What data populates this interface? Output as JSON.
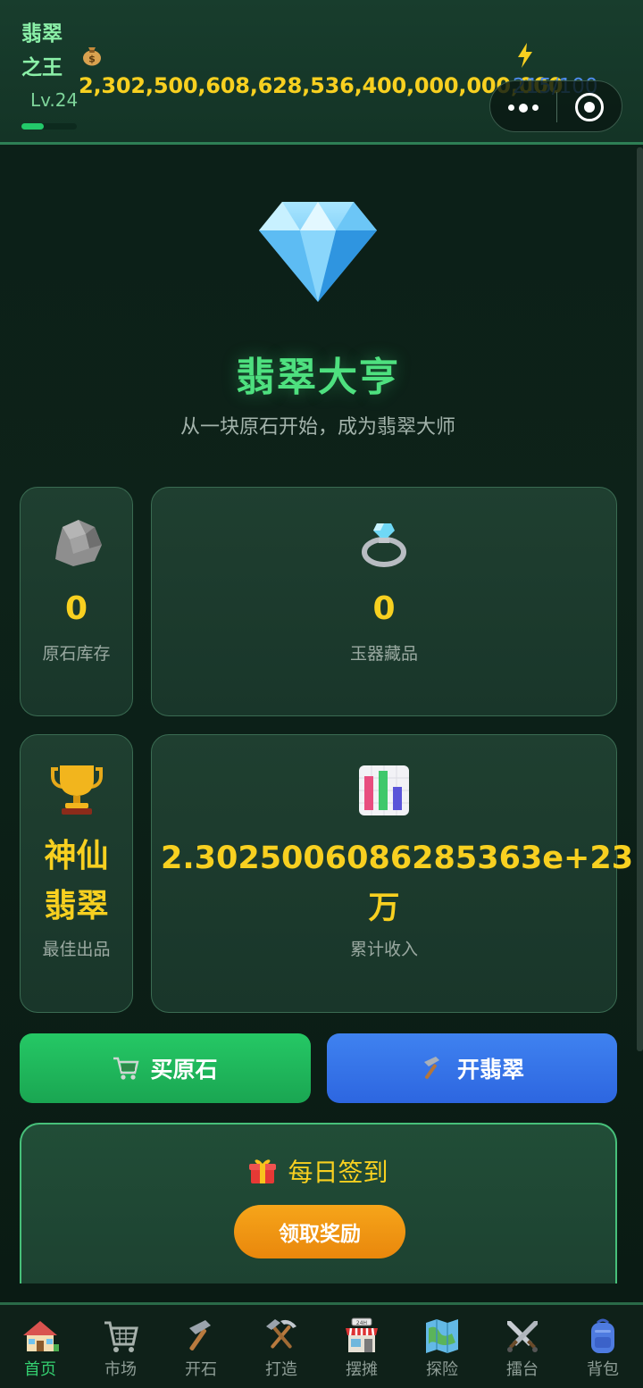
{
  "header": {
    "title_line1": "翡翠",
    "title_line2": "之王",
    "level": "Lv.24",
    "xp_fraction": 0.4,
    "money_icon": "money-bag-icon",
    "money": "2,302,500,608,628,536,400,000,000,000",
    "energy_icon": "lightning-icon",
    "energy": "215/100"
  },
  "hero": {
    "icon": "diamond-icon",
    "title": "翡翠大亨",
    "subtitle": "从一块原石开始，成为翡翠大师"
  },
  "stats": [
    {
      "icon": "rock-icon",
      "value": "0",
      "label": "原石库存"
    },
    {
      "icon": "ring-icon",
      "value": "0",
      "label": "玉器藏品"
    },
    {
      "icon": "trophy-icon",
      "value": "神仙翡翠",
      "label": "最佳出品"
    },
    {
      "icon": "bar-chart-icon",
      "value": "2.3025006086285363e+23万",
      "label": "累计收入"
    }
  ],
  "actions": {
    "buy_label": "买原石",
    "buy_icon": "cart-icon",
    "open_label": "开翡翠",
    "open_icon": "hammer-icon"
  },
  "daily": {
    "icon": "gift-icon",
    "title": "每日签到",
    "claim_label": "领取奖励"
  },
  "nav": {
    "active": "首页",
    "items": [
      {
        "label": "首页",
        "icon": "house-icon"
      },
      {
        "label": "市场",
        "icon": "cart-icon"
      },
      {
        "label": "开石",
        "icon": "hammer-icon"
      },
      {
        "label": "打造",
        "icon": "hammer-pick-icon"
      },
      {
        "label": "摆摊",
        "icon": "shop-icon"
      },
      {
        "label": "探险",
        "icon": "map-icon"
      },
      {
        "label": "擂台",
        "icon": "crossed-swords-icon"
      },
      {
        "label": "背包",
        "icon": "backpack-icon"
      }
    ]
  },
  "colors": {
    "accent_green": "#4ee07f",
    "gold": "#f8d020",
    "button_green": "#1fb75b",
    "button_blue": "#3574e8",
    "button_orange": "#f09a14"
  }
}
